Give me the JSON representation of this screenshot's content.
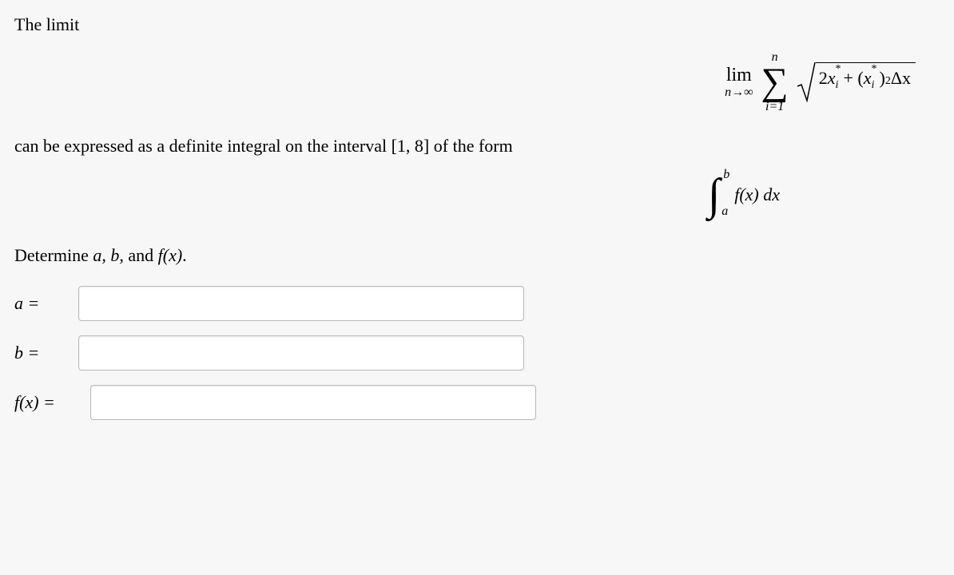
{
  "intro": "The limit",
  "limit": {
    "lim_word": "lim",
    "lim_sub": "n→∞",
    "sum_top": "n",
    "sum_bottom": "i=1",
    "expr": {
      "coef": "2",
      "var": "x",
      "star": "*",
      "idx": "i",
      "plus": " + (",
      "var2": "x",
      "star2": "*",
      "idx2": "i",
      "close": ")",
      "sq": "2",
      "dx": "Δx"
    }
  },
  "line2_pre": "can be expressed as a definite integral on the interval ",
  "interval": "[1, 8]",
  "line2_post": " of the form",
  "integral": {
    "top": "b",
    "bottom": "a",
    "expr": "f(x) dx"
  },
  "determine_pre": "Determine ",
  "determine_vars": "a, b,",
  "determine_mid": " and ",
  "determine_fx": "f(x)",
  "determine_post": ".",
  "labels": {
    "a": "a =",
    "b": "b =",
    "fx": "f(x) ="
  }
}
